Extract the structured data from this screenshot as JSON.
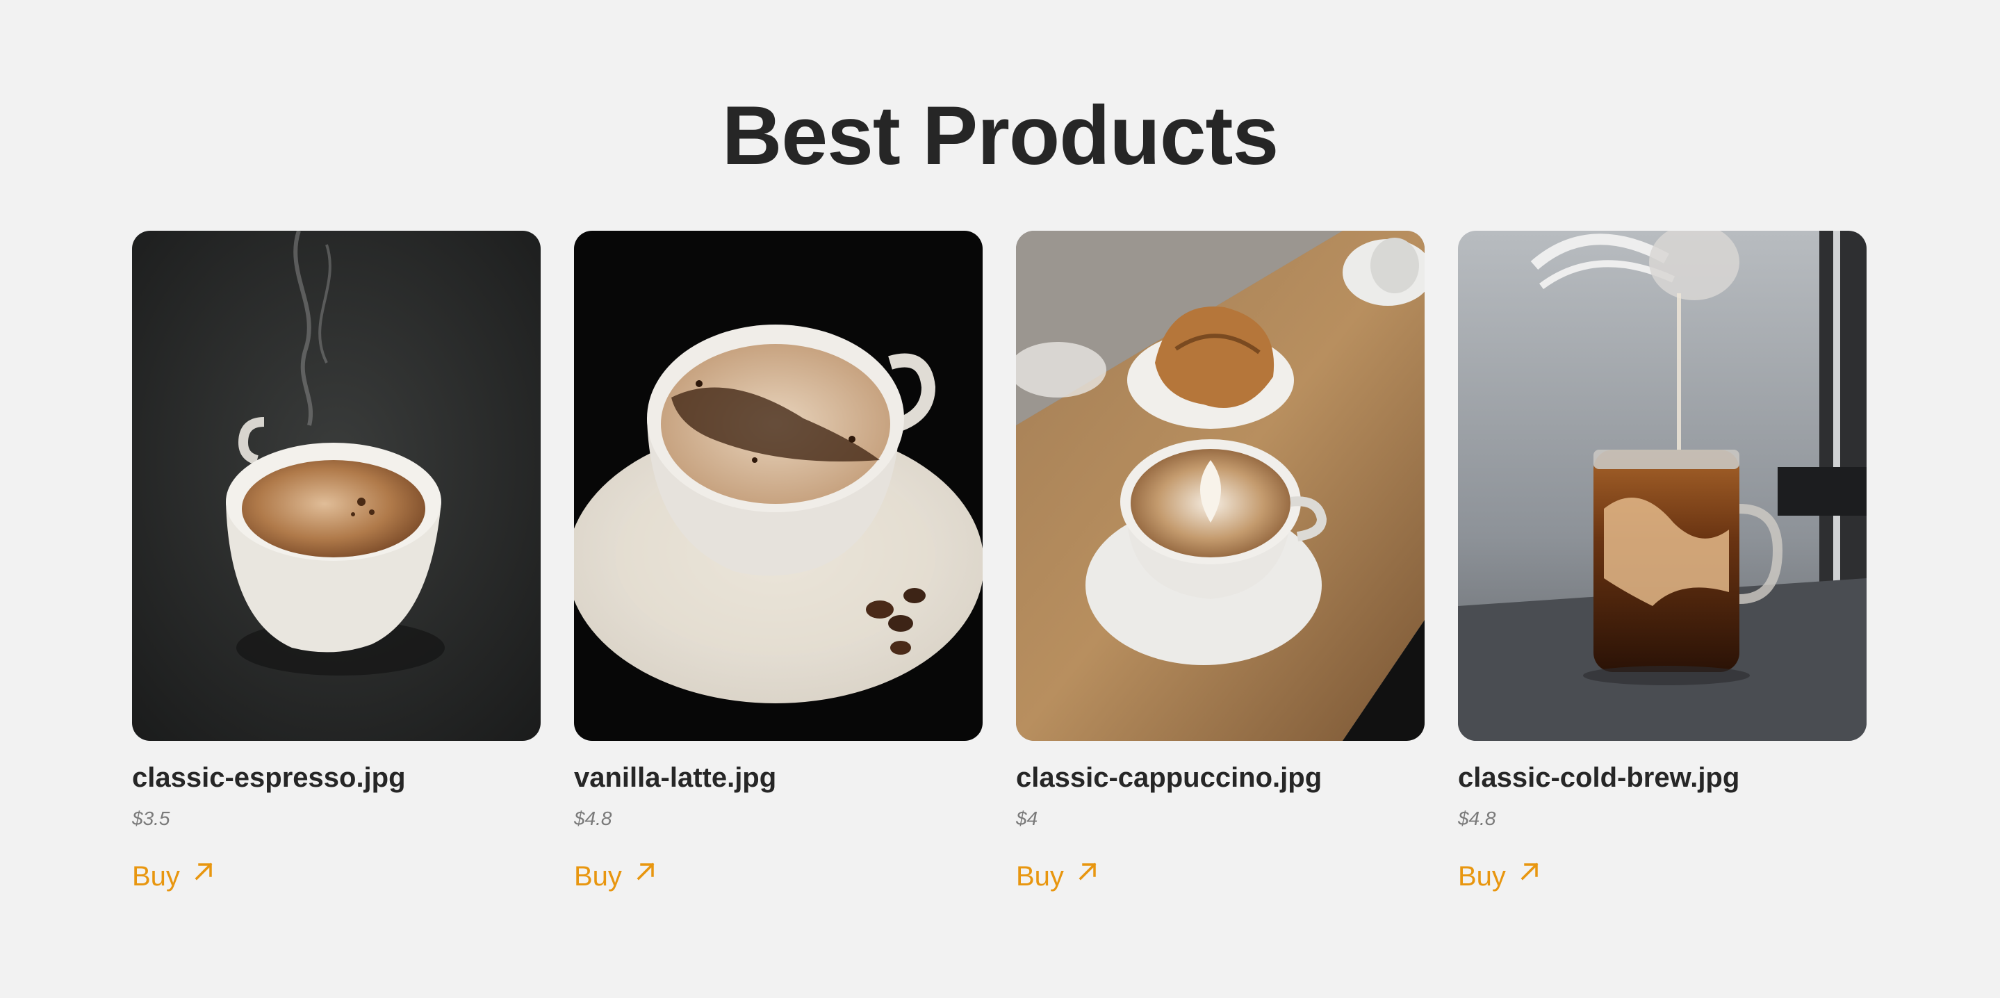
{
  "section": {
    "title": "Best Products"
  },
  "products": [
    {
      "name": "classic-espresso.jpg",
      "price": "$3.5",
      "cta": "Buy"
    },
    {
      "name": "vanilla-latte.jpg",
      "price": "$4.8",
      "cta": "Buy"
    },
    {
      "name": "classic-cappuccino.jpg",
      "price": "$4",
      "cta": "Buy"
    },
    {
      "name": "classic-cold-brew.jpg",
      "price": "$4.8",
      "cta": "Buy"
    }
  ],
  "colors": {
    "background": "#f2f2f2",
    "title": "#262626",
    "price": "#7a7a7a",
    "accent": "#e8960f"
  },
  "icons": {
    "buy_arrow": "arrow-up-right-icon"
  }
}
